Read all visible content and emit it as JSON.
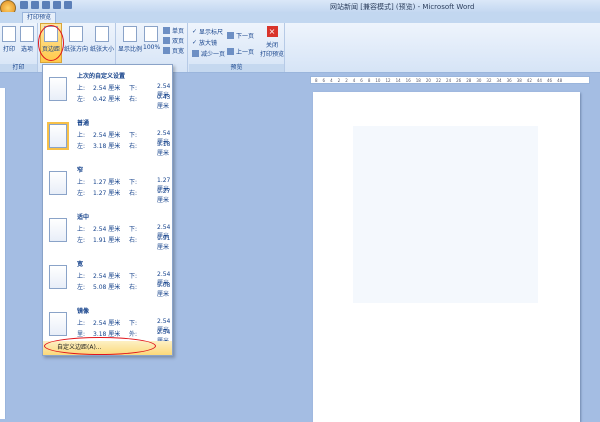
{
  "window": {
    "title": "网站新闻 [兼容模式] (预览) - Microsoft Word"
  },
  "tabs": [
    {
      "label": "打印预览"
    }
  ],
  "ribbon": {
    "print_group": {
      "label": "打印",
      "buttons": [
        "打印",
        "选项"
      ]
    },
    "page_setup": {
      "buttons": [
        "页边距",
        "纸张方向",
        "纸张大小"
      ]
    },
    "zoom": {
      "buttons": [
        "显示比例",
        "100%"
      ],
      "small": [
        "单页",
        "双页",
        "页宽"
      ]
    },
    "preview": {
      "label": "预览",
      "checks": [
        "显示标尺",
        "放大镜"
      ],
      "shrink": "减少一页",
      "next": "下一页",
      "prev": "上一页",
      "close": "关闭\n打印预览"
    }
  },
  "ruler": [
    "8",
    "6",
    "4",
    "2",
    "2",
    "4",
    "6",
    "8",
    "10",
    "12",
    "14",
    "16",
    "18",
    "20",
    "22",
    "24",
    "26",
    "28",
    "30",
    "32",
    "34",
    "36",
    "38",
    "42",
    "44",
    "46",
    "48"
  ],
  "margins_menu": {
    "items": [
      {
        "name": "上次的自定义设置",
        "r1": [
          "上:",
          "2.54 厘米",
          "下:",
          "2.54 厘米"
        ],
        "r2": [
          "左:",
          "0.42 厘米",
          "右:",
          "0.43 厘米"
        ]
      },
      {
        "name": "普通",
        "r1": [
          "上:",
          "2.54 厘米",
          "下:",
          "2.54 厘米"
        ],
        "r2": [
          "左:",
          "3.18 厘米",
          "右:",
          "3.18 厘米"
        ]
      },
      {
        "name": "窄",
        "r1": [
          "上:",
          "1.27 厘米",
          "下:",
          "1.27 厘米"
        ],
        "r2": [
          "左:",
          "1.27 厘米",
          "右:",
          "1.27 厘米"
        ]
      },
      {
        "name": "适中",
        "r1": [
          "上:",
          "2.54 厘米",
          "下:",
          "2.54 厘米"
        ],
        "r2": [
          "左:",
          "1.91 厘米",
          "右:",
          "1.91 厘米"
        ]
      },
      {
        "name": "宽",
        "r1": [
          "上:",
          "2.54 厘米",
          "下:",
          "2.54 厘米"
        ],
        "r2": [
          "左:",
          "5.08 厘米",
          "右:",
          "5.08 厘米"
        ]
      },
      {
        "name": "镜像",
        "r1": [
          "上:",
          "2.54 厘米",
          "下:",
          "2.54 厘米"
        ],
        "r2": [
          "里:",
          "3.18 厘米",
          "外:",
          "2.54 厘米"
        ]
      }
    ],
    "custom": "自定义边距(A)..."
  }
}
